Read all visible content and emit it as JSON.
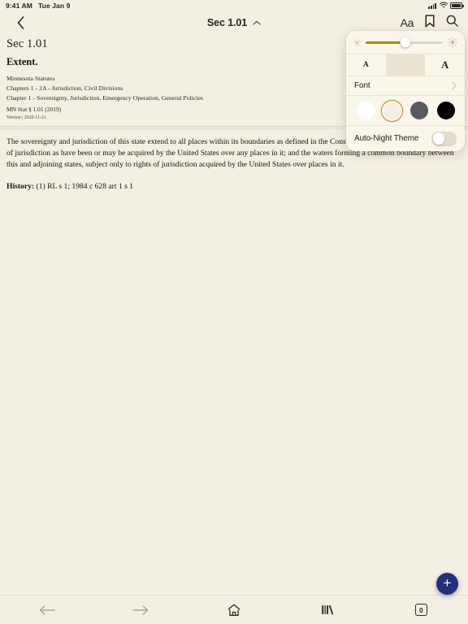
{
  "status_bar": {
    "time": "9:41 AM",
    "date": "Tue Jan 9",
    "cellular_icon": "cellular-bars-icon",
    "wifi_icon": "wifi-icon",
    "battery_icon": "battery-full-icon"
  },
  "nav_bar": {
    "back_icon": "chevron-left-icon",
    "title": "Sec 1.01",
    "title_chevron_icon": "chevron-up-icon",
    "text_settings_label": "Aa",
    "bookmark_icon": "bookmark-icon",
    "search_icon": "search-icon"
  },
  "document": {
    "section": "Sec 1.01",
    "heading": "Extent.",
    "source": "Minnesota Statutes",
    "chapters": "Chapters 1 - 2A - Jurisdiction, Civil Divisions",
    "chapter": "Chapter 1 - Sovereignty, Jurisdiction, Emergency Operation, General Policies",
    "citation": "MN Stat § 1.01 (2019)",
    "version": "Version | 2020-11-21",
    "body": "The sovereignty and jurisdiction of this state extend to all places within its boundaries as defined in the Constitution, subject only to such rights of jurisdiction as have been or may be acquired by the United States over any places in it; and the waters forming a common boundary between this and adjoining states, subject only to rights of jurisdiction acquired by the United States over places in it.",
    "history_label": "History:",
    "history_value": "(1) RL s 1; 1984 c 628 art 1 s 1"
  },
  "popover": {
    "brightness": {
      "low_icon": "sun-small-icon",
      "high_icon": "sun-large-icon",
      "value_percent": 52
    },
    "font_size": {
      "decrease_label": "A",
      "increase_label": "A"
    },
    "font_row": {
      "label": "Font",
      "chevron_icon": "chevron-right-icon"
    },
    "themes": [
      {
        "name": "white",
        "color": "#ffffff",
        "selected": false
      },
      {
        "name": "sepia",
        "color": "#f5efe2",
        "selected": true
      },
      {
        "name": "gray",
        "color": "#58595d",
        "selected": false
      },
      {
        "name": "black",
        "color": "#000000",
        "selected": false
      }
    ],
    "selected_ring_color": "#bd9a3f",
    "auto_night": {
      "label": "Auto-Night Theme",
      "enabled": false
    }
  },
  "fab": {
    "icon": "plus-icon",
    "color": "#21307c"
  },
  "bottom_bar": {
    "items": [
      {
        "name": "back",
        "icon": "arrow-left-icon",
        "dim": true,
        "label": ""
      },
      {
        "name": "forward",
        "icon": "arrow-right-icon",
        "dim": true,
        "label": ""
      },
      {
        "name": "home",
        "icon": "home-icon",
        "dim": false,
        "label": ""
      },
      {
        "name": "library",
        "icon": "library-icon",
        "dim": false,
        "label": ""
      },
      {
        "name": "tabs",
        "icon": "tab-count-icon",
        "dim": false,
        "label": "0"
      }
    ],
    "tab_count": "0"
  },
  "theme": {
    "page_background": "#f4efe3",
    "popover_background": "#fbf6ea",
    "accent": "#b8860b"
  }
}
